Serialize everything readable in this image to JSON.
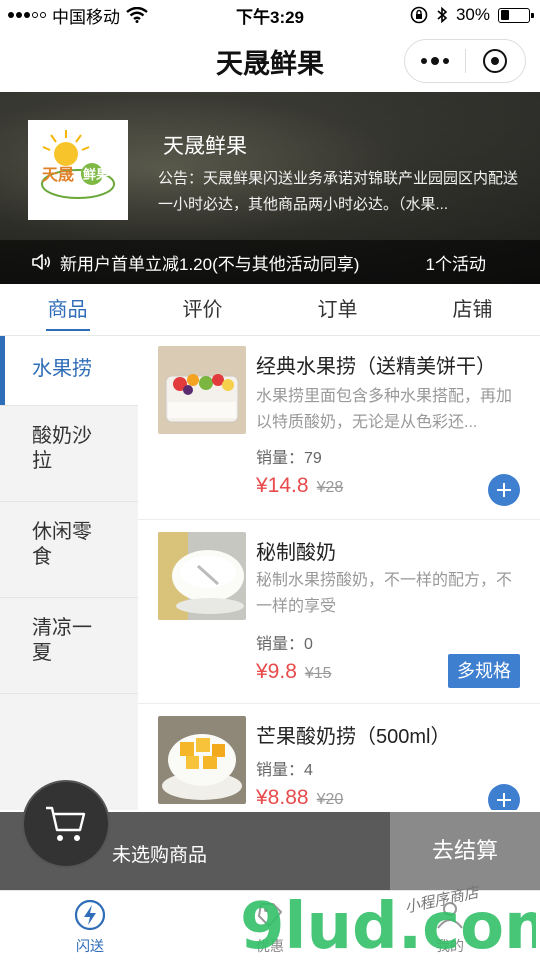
{
  "status_bar": {
    "carrier": "中国移动",
    "time": "下午3:29",
    "battery": "30%",
    "battery_level": 0.3
  },
  "nav": {
    "title": "天晟鲜果"
  },
  "shop": {
    "name": "天晟鲜果",
    "notice": "公告：天晟鲜果闪送业务承诺对锦联产业园园区内配送一小时必达，其他商品两小时必达。（水果...",
    "promo_text": "新用户首单立减1.20(不与其他活动同享)",
    "promo_count": "1个活动"
  },
  "tabs": [
    {
      "label": "商品",
      "active": true
    },
    {
      "label": "评价",
      "active": false
    },
    {
      "label": "订单",
      "active": false
    },
    {
      "label": "店铺",
      "active": false
    }
  ],
  "categories": [
    {
      "label": "水果捞",
      "active": true
    },
    {
      "label": "酸奶沙拉",
      "active": false
    },
    {
      "label": "休闲零食",
      "active": false
    },
    {
      "label": "清凉一夏",
      "active": false
    }
  ],
  "products": [
    {
      "name": "经典水果捞（送精美饼干）",
      "desc": "水果捞里面包含多种水果搭配，再加以特质酸奶，无论是从色彩还...",
      "sales_label": "销量：79",
      "price": "¥14.8",
      "original_price": "¥28",
      "action": "add"
    },
    {
      "name": "秘制酸奶",
      "desc": "秘制水果捞酸奶，不一样的配方，不一样的享受",
      "sales_label": "销量：0",
      "price": "¥9.8",
      "original_price": "¥15",
      "action": "spec",
      "spec_label": "多规格"
    },
    {
      "name": "芒果酸奶捞（500ml）",
      "sales_label": "销量：4",
      "price": "¥8.88",
      "original_price": "¥20",
      "action": "add"
    }
  ],
  "cart": {
    "empty_text": "未选购商品",
    "checkout_label": "去结算"
  },
  "bottom_tabs": [
    {
      "label": "闪送",
      "icon": "lightning-icon",
      "active": true
    },
    {
      "label": "优惠",
      "icon": "coupon-icon",
      "active": false
    },
    {
      "label": "我的",
      "icon": "user-icon",
      "active": false
    }
  ],
  "watermark": {
    "text": "9lud.com",
    "subtext": "小程序商店"
  },
  "colors": {
    "accent": "#2f6db8",
    "price": "#e84b4b",
    "button": "#3f7fd0"
  }
}
